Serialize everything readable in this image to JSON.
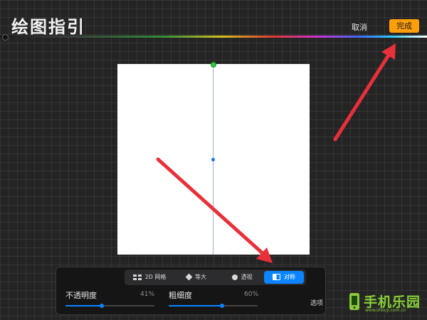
{
  "header": {
    "title": "绘图指引",
    "cancel_label": "取消",
    "done_label": "完成"
  },
  "tabs": [
    {
      "label": "2D 网格",
      "icon": "grid-icon",
      "active": false
    },
    {
      "label": "等大",
      "icon": "isometric-icon",
      "active": false
    },
    {
      "label": "透视",
      "icon": "perspective-icon",
      "active": false
    },
    {
      "label": "对称",
      "icon": "symmetry-icon",
      "active": true
    }
  ],
  "sliders": {
    "opacity": {
      "label": "不透明度",
      "value_text": "41%",
      "value": 0.41
    },
    "thickness": {
      "label": "粗细度",
      "value_text": "60%",
      "value": 0.6
    }
  },
  "options_label": "选项",
  "watermark": {
    "text": "手机乐园",
    "url": "www.shouji.com.cn"
  },
  "colors": {
    "accent": "#0a84ff",
    "done_button": "#ff9f0a",
    "arrow": "#e8303a",
    "watermark": "#8dc63f"
  }
}
